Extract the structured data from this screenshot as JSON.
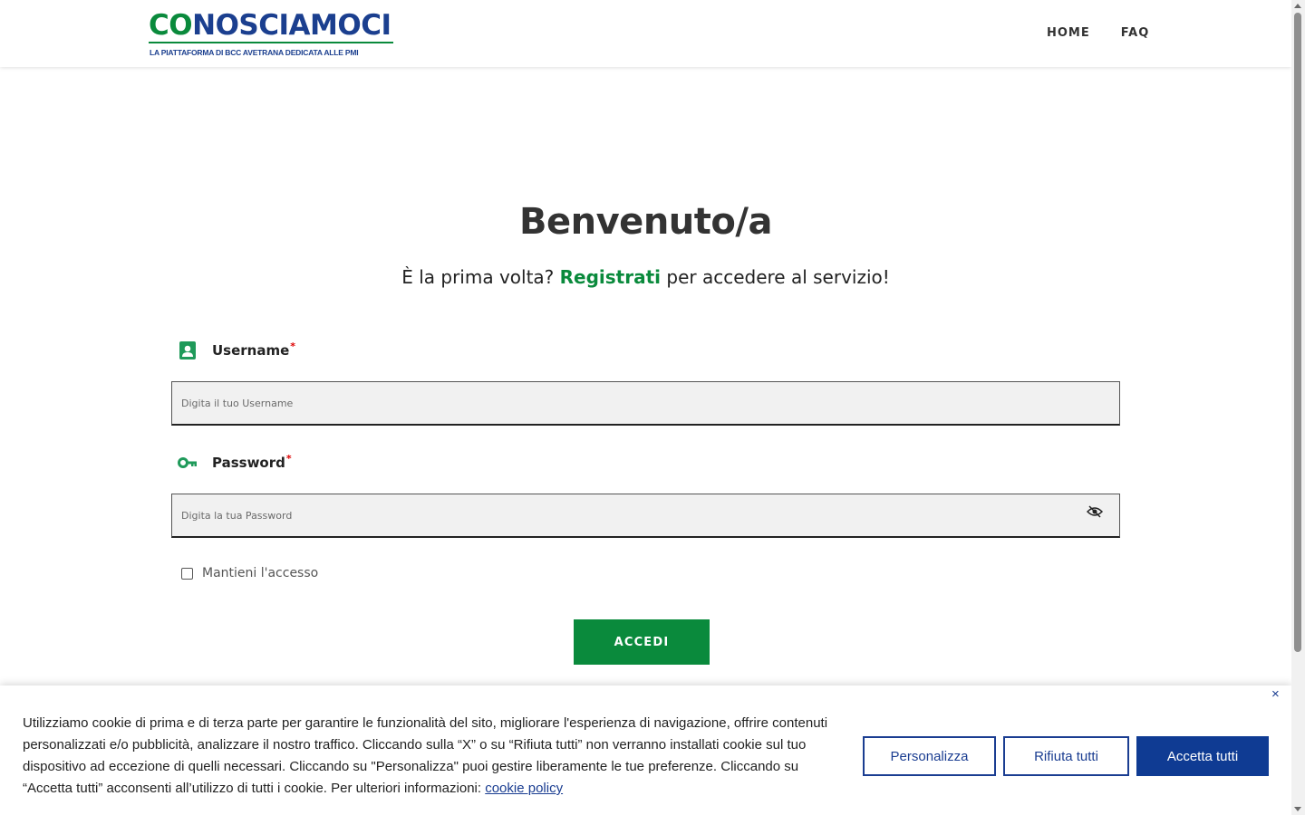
{
  "header": {
    "logo_text": "CONOSCIAMOCI",
    "logo_tagline": "LA PIATTAFORMA DI BCC AVETRANA DEDICATA ALLE PMI",
    "nav": [
      {
        "label": "HOME"
      },
      {
        "label": "FAQ"
      }
    ]
  },
  "main": {
    "title": "Benvenuto/a",
    "subtitle_before": "È la prima volta?",
    "subtitle_link": "Registrati",
    "subtitle_after": "per accedere al servizio!",
    "username": {
      "label": "Username",
      "required_mark": "*",
      "placeholder": "Digita il tuo Username",
      "value": "",
      "icon": "contact-card-icon"
    },
    "password": {
      "label": "Password",
      "required_mark": "*",
      "placeholder": "Digita la tua Password",
      "value": "",
      "icon": "key-icon",
      "toggle_icon": "eye-off-icon"
    },
    "remember_label": "Mantieni l'accesso",
    "remember_checked": false,
    "submit_label": "ACCEDI"
  },
  "cookie": {
    "text": "Utilizziamo cookie di prima e di terza parte per garantire le funzionalità del sito, migliorare l'esperienza di navigazione, offrire contenuti personalizzati e/o pubblicità, analizzare il nostro traffico. Cliccando sulla “X” o su “Rifiuta tutti” non verranno installati cookie sul tuo dispositivo ad eccezione di quelli necessari. Cliccando su \"Personalizza\" puoi gestire liberamente le tue preferenze. Cliccando su “Accetta tutti” acconsenti all’utilizzo di tutti i cookie. Per ulteriori informazioni:",
    "link_text": "cookie policy",
    "close_label": "×",
    "buttons": {
      "customize": "Personalizza",
      "reject": "Rifiuta tutti",
      "accept": "Accetta tutti"
    }
  },
  "colors": {
    "brand_green": "#0a8a3c",
    "brand_blue": "#1b3f8f",
    "cookie_blue": "#0f3b93"
  }
}
